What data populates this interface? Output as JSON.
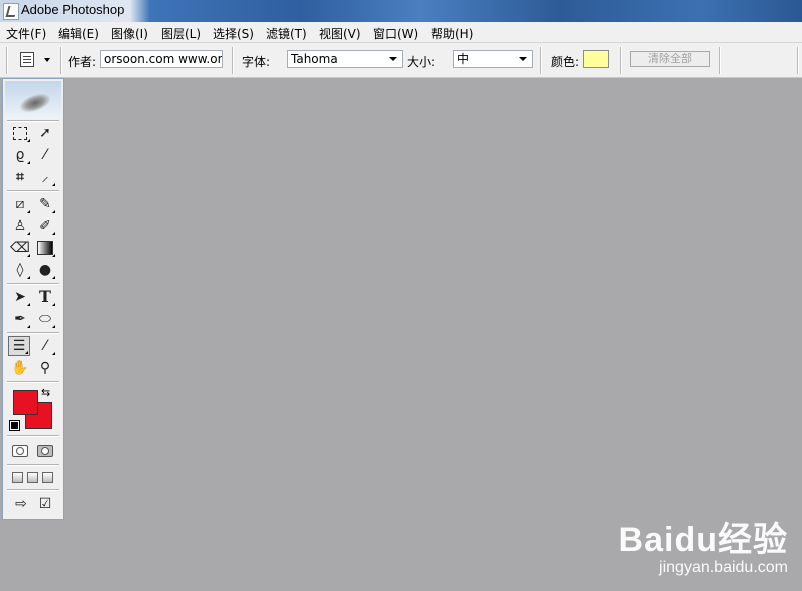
{
  "window": {
    "title": "Adobe Photoshop"
  },
  "menu": {
    "items": [
      {
        "label": "文件(F)"
      },
      {
        "label": "编辑(E)"
      },
      {
        "label": "图像(I)"
      },
      {
        "label": "图层(L)"
      },
      {
        "label": "选择(S)"
      },
      {
        "label": "滤镜(T)"
      },
      {
        "label": "视图(V)"
      },
      {
        "label": "窗口(W)"
      },
      {
        "label": "帮助(H)"
      }
    ]
  },
  "options": {
    "author_label": "作者:",
    "author_value": "orsoon.com www.ors",
    "font_label": "字体:",
    "font_value": "Tahoma",
    "size_label": "大小:",
    "size_value": "中",
    "color_label": "颜色:",
    "color_value": "#fefe9c",
    "clear_all_label": "清除全部"
  },
  "toolbox": {
    "foreground_color": "#e81123",
    "background_color": "#e81123",
    "tools": [
      "rectangular-marquee",
      "move",
      "lasso",
      "magic-wand",
      "crop",
      "slice",
      "healing-brush",
      "brush",
      "clone-stamp",
      "history-brush",
      "eraser",
      "gradient",
      "blur",
      "dodge",
      "path-selection",
      "type",
      "pen",
      "ellipse-shape",
      "notes",
      "eyedropper",
      "hand",
      "zoom"
    ],
    "active_tool": "notes"
  },
  "watermark": {
    "logo_text": "Baidu经验",
    "url": "jingyan.baidu.com"
  }
}
